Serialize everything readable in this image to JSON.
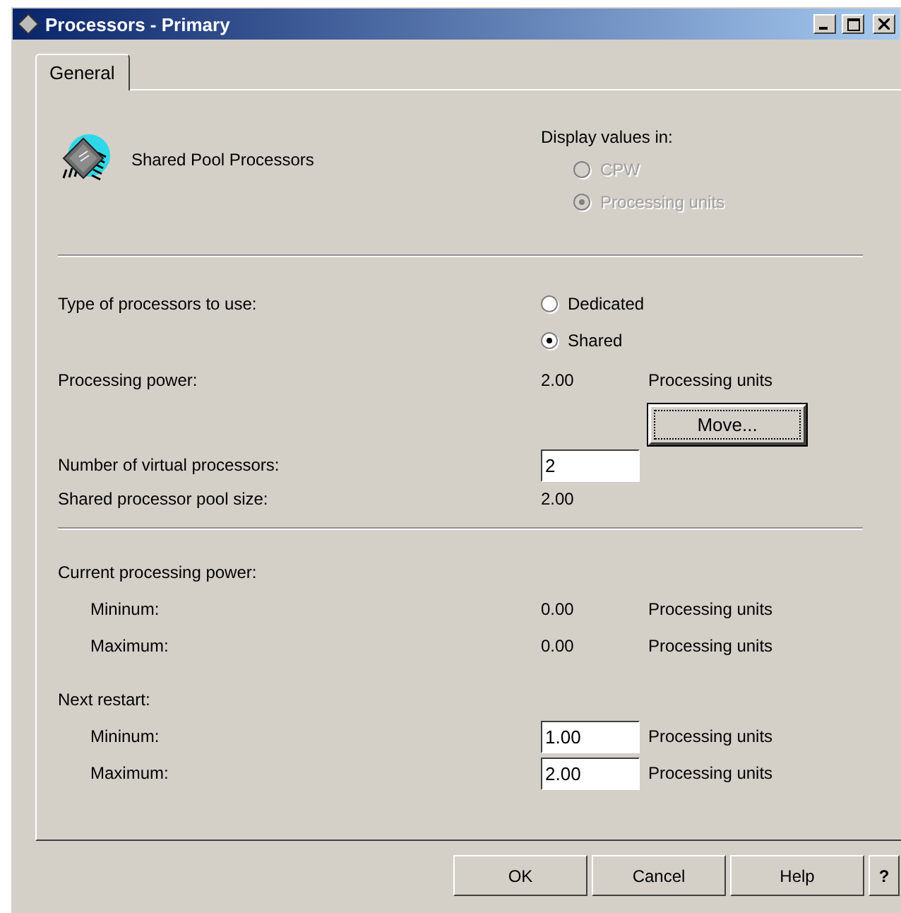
{
  "window": {
    "title": "Processors - Primary"
  },
  "tabs": [
    {
      "label": "General",
      "selected": true
    }
  ],
  "header": {
    "title": "Shared Pool Processors",
    "display_values": {
      "label": "Display values in:",
      "disabled": true,
      "options": [
        {
          "label": "CPW",
          "selected": false
        },
        {
          "label": "Processing units",
          "selected": true
        }
      ]
    }
  },
  "processor_type": {
    "label": "Type of processors to use:",
    "options": [
      {
        "label": "Dedicated",
        "selected": false
      },
      {
        "label": "Shared",
        "selected": true
      }
    ]
  },
  "processing_power": {
    "label": "Processing power:",
    "value": "2.00",
    "unit": "Processing units",
    "button": "Move..."
  },
  "virtual_processors": {
    "label": "Number of virtual processors:",
    "value": "2"
  },
  "pool_size": {
    "label": "Shared processor pool size:",
    "value": "2.00"
  },
  "current": {
    "label": "Current processing power:",
    "rows": [
      {
        "label": "Mininum:",
        "value": "0.00",
        "unit": "Processing units"
      },
      {
        "label": "Maximum:",
        "value": "0.00",
        "unit": "Processing units"
      }
    ]
  },
  "next_restart": {
    "label": "Next restart:",
    "rows": [
      {
        "label": "Mininum:",
        "value": "1.00",
        "unit": "Processing units"
      },
      {
        "label": "Maximum:",
        "value": "2.00",
        "unit": "Processing units"
      }
    ]
  },
  "buttons": [
    {
      "label": "OK"
    },
    {
      "label": "Cancel"
    },
    {
      "label": "Help"
    },
    {
      "label": "?"
    }
  ]
}
